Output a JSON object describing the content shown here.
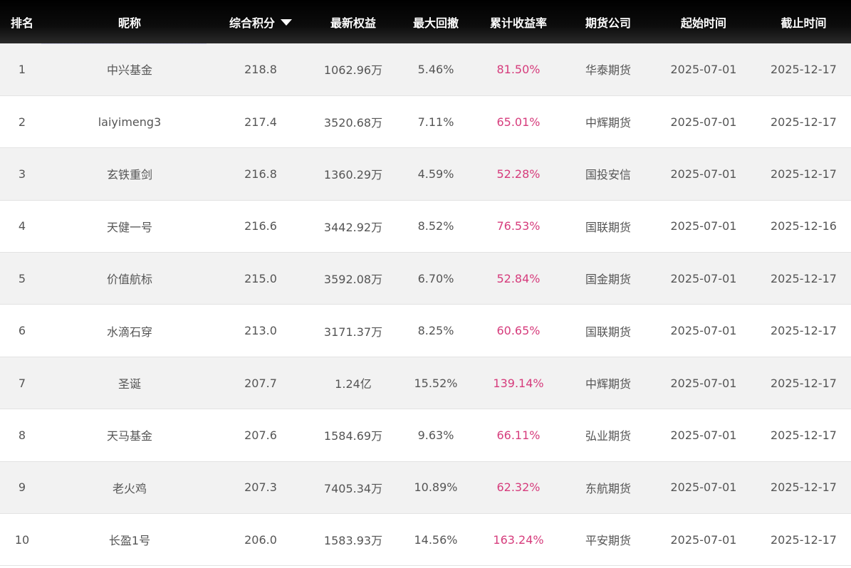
{
  "table": {
    "headers": {
      "rank": "排名",
      "nickname": "昵称",
      "score": "综合积分",
      "equity": "最新权益",
      "drawdown": "最大回撤",
      "return": "累计收益率",
      "company": "期货公司",
      "start": "起始时间",
      "end": "截止时间"
    },
    "sort_icon": "triangle-down-icon",
    "return_color": "#d63c7c",
    "rows": [
      {
        "rank": "1",
        "nickname": "中兴基金",
        "score": "218.8",
        "equity": "1062.96万",
        "drawdown": "5.46%",
        "return": "81.50%",
        "company": "华泰期货",
        "start": "2025-07-01",
        "end": "2025-12-17"
      },
      {
        "rank": "2",
        "nickname": "laiyimeng3",
        "score": "217.4",
        "equity": "3520.68万",
        "drawdown": "7.11%",
        "return": "65.01%",
        "company": "中辉期货",
        "start": "2025-07-01",
        "end": "2025-12-17"
      },
      {
        "rank": "3",
        "nickname": "玄铁重剑",
        "score": "216.8",
        "equity": "1360.29万",
        "drawdown": "4.59%",
        "return": "52.28%",
        "company": "国投安信",
        "start": "2025-07-01",
        "end": "2025-12-17"
      },
      {
        "rank": "4",
        "nickname": "天健一号",
        "score": "216.6",
        "equity": "3442.92万",
        "drawdown": "8.52%",
        "return": "76.53%",
        "company": "国联期货",
        "start": "2025-07-01",
        "end": "2025-12-16"
      },
      {
        "rank": "5",
        "nickname": "价值航标",
        "score": "215.0",
        "equity": "3592.08万",
        "drawdown": "6.70%",
        "return": "52.84%",
        "company": "国金期货",
        "start": "2025-07-01",
        "end": "2025-12-17"
      },
      {
        "rank": "6",
        "nickname": "水滴石穿",
        "score": "213.0",
        "equity": "3171.37万",
        "drawdown": "8.25%",
        "return": "60.65%",
        "company": "国联期货",
        "start": "2025-07-01",
        "end": "2025-12-17"
      },
      {
        "rank": "7",
        "nickname": "圣诞",
        "score": "207.7",
        "equity": "1.24亿",
        "drawdown": "15.52%",
        "return": "139.14%",
        "company": "中辉期货",
        "start": "2025-07-01",
        "end": "2025-12-17"
      },
      {
        "rank": "8",
        "nickname": "天马基金",
        "score": "207.6",
        "equity": "1584.69万",
        "drawdown": "9.63%",
        "return": "66.11%",
        "company": "弘业期货",
        "start": "2025-07-01",
        "end": "2025-12-17"
      },
      {
        "rank": "9",
        "nickname": "老火鸡",
        "score": "207.3",
        "equity": "7405.34万",
        "drawdown": "10.89%",
        "return": "62.32%",
        "company": "东航期货",
        "start": "2025-07-01",
        "end": "2025-12-17"
      },
      {
        "rank": "10",
        "nickname": "长盈1号",
        "score": "206.0",
        "equity": "1583.93万",
        "drawdown": "14.56%",
        "return": "163.24%",
        "company": "平安期货",
        "start": "2025-07-01",
        "end": "2025-12-17"
      }
    ]
  }
}
